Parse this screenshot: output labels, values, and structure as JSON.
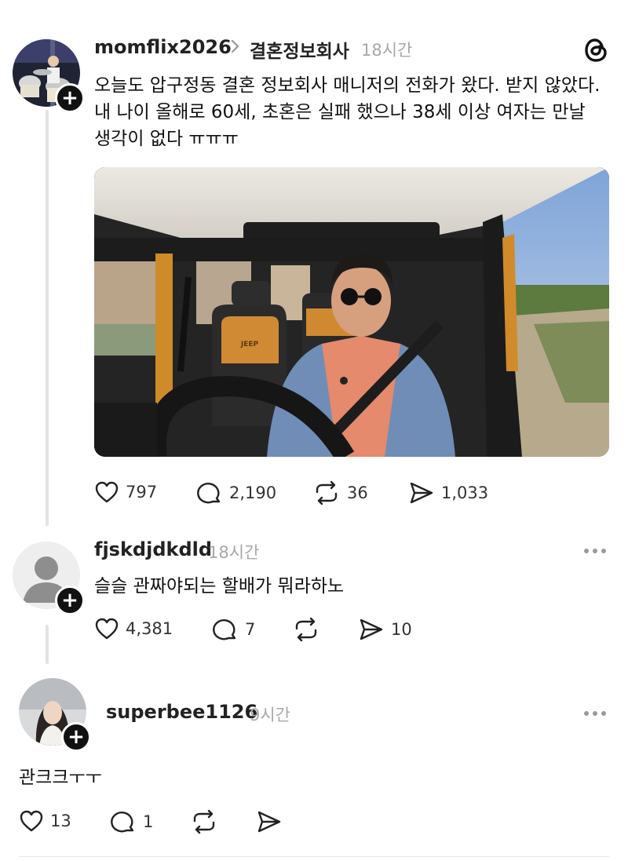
{
  "post": {
    "username": "momflix2026",
    "topic": "결혼정보회사",
    "time": "18시간",
    "text": "오늘도 압구정동 결혼 정보회사 매니저의 전화가 왔다. 받지 않았다. 내 나이 올해로 60세, 초혼은 실패 했으나 38세 이상 여자는 만날 생각이 없다 ㅠㅠㅠ",
    "likes": "797",
    "replies": "2,190",
    "reposts": "36",
    "shares": "1,033",
    "seat_brand": "JEEP"
  },
  "reply1": {
    "username": "fjskdjdkdld",
    "time": "18시간",
    "text": "슬슬 관짜야되는 할배가 뭐라하노",
    "likes": "4,381",
    "replies": "7",
    "shares": "10"
  },
  "reply2": {
    "username": "superbee1126",
    "time": "9시간",
    "text": "관크크ㅜㅜ",
    "likes": "13",
    "replies": "1"
  },
  "icons": {
    "app": "threads-logo-icon",
    "like": "heart-icon",
    "reply": "comment-bubble-icon",
    "repost": "repost-icon",
    "share": "send-icon",
    "follow": "plus-icon",
    "more": "more-horizontal-icon"
  },
  "colors": {
    "text": "#101010",
    "muted": "#a8a8a8",
    "thread_line": "#e3e3e3"
  }
}
